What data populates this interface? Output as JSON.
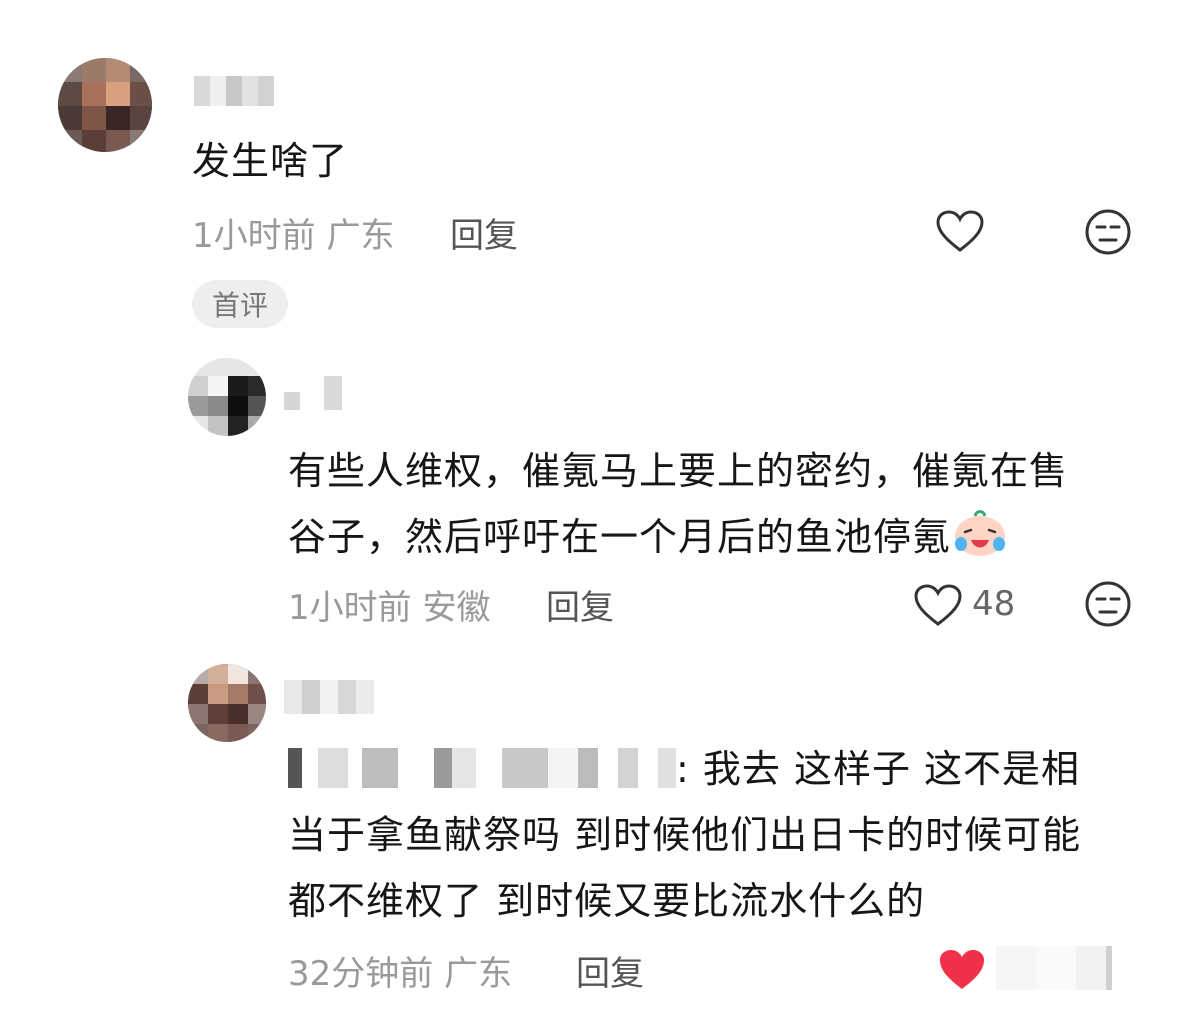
{
  "comments": [
    {
      "text": "发生啥了",
      "time": "1小时前",
      "location": "广东",
      "reply_label": "回复",
      "badge": "首评"
    },
    {
      "text_line1": "有些人维权，催氪马上要上的密约，催氪在售",
      "text_line2": "谷子，然后呼吁在一个月后的鱼池停氪",
      "emoji": "laugh-cry-emoji",
      "time": "1小时前",
      "location": "安徽",
      "reply_label": "回复",
      "likes": "48"
    },
    {
      "text_line1_suffix": ": 我去 这样子 这不是相",
      "text_line2": "当于拿鱼献祭吗 到时候他们出日卡的时候可能",
      "text_line3": "都不维权了 到时候又要比流水什么的",
      "time": "32分钟前",
      "location": "广东",
      "reply_label": "回复",
      "liked": true
    }
  ],
  "colors": {
    "liked_heart": "#f0314a",
    "meta": "#9a9a9a"
  }
}
